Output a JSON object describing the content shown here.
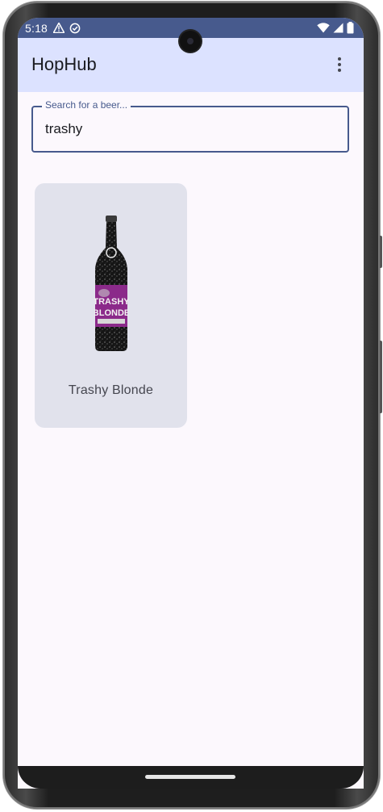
{
  "status_bar": {
    "time": "5:18",
    "left_icons": [
      "warning-icon",
      "sync-check-icon"
    ],
    "right_icons": [
      "wifi-icon",
      "signal-icon",
      "battery-icon"
    ]
  },
  "app_bar": {
    "title": "HopHub",
    "menu_icon": "more-vert-icon"
  },
  "search": {
    "label": "Search for a beer...",
    "value": "trashy"
  },
  "results": [
    {
      "name": "Trashy Blonde",
      "image": "beer-bottle"
    }
  ],
  "colors": {
    "primary": "#475a8d",
    "app_bar_bg": "#dce2ff",
    "background": "#fcf8fd",
    "card_bg": "#e1e2ec",
    "label_purple": "#8b2a8a"
  }
}
